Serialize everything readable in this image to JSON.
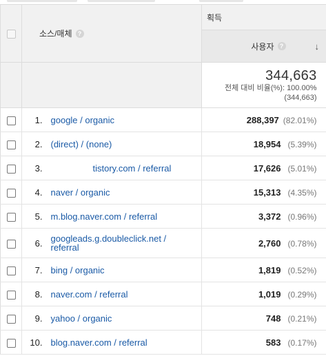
{
  "header": {
    "source_label": "소스/매체",
    "group_label": "획득",
    "metric_label": "사용자",
    "help_glyph": "?",
    "sort_glyph": "↓"
  },
  "totals": {
    "value": "344,663",
    "percent_text": "전체 대비 비율(%): 100.00%",
    "total_text": "(344,663)"
  },
  "rows": [
    {
      "num": "1.",
      "source": "google / organic",
      "users": "288,397",
      "pct": "(82.01%)"
    },
    {
      "num": "2.",
      "source": "(direct) / (none)",
      "users": "18,954",
      "pct": "(5.39%)"
    },
    {
      "num": "3.",
      "source": "tistory.com / referral",
      "users": "17,626",
      "pct": "(5.01%)"
    },
    {
      "num": "4.",
      "source": "naver / organic",
      "users": "15,313",
      "pct": "(4.35%)"
    },
    {
      "num": "5.",
      "source": "m.blog.naver.com / referral",
      "users": "3,372",
      "pct": "(0.96%)"
    },
    {
      "num": "6.",
      "source": "googleads.g.doubleclick.net / referral",
      "users": "2,760",
      "pct": "(0.78%)"
    },
    {
      "num": "7.",
      "source": "bing / organic",
      "users": "1,819",
      "pct": "(0.52%)"
    },
    {
      "num": "8.",
      "source": "naver.com / referral",
      "users": "1,019",
      "pct": "(0.29%)"
    },
    {
      "num": "9.",
      "source": "yahoo / organic",
      "users": "748",
      "pct": "(0.21%)"
    },
    {
      "num": "10.",
      "source": "blog.naver.com / referral",
      "users": "583",
      "pct": "(0.17%)"
    }
  ],
  "colors": {
    "link": "#1a5aa6",
    "header_bg": "#f1f1f1",
    "metric_header_bg": "#e9e9e9",
    "border": "#dcdcdc"
  }
}
